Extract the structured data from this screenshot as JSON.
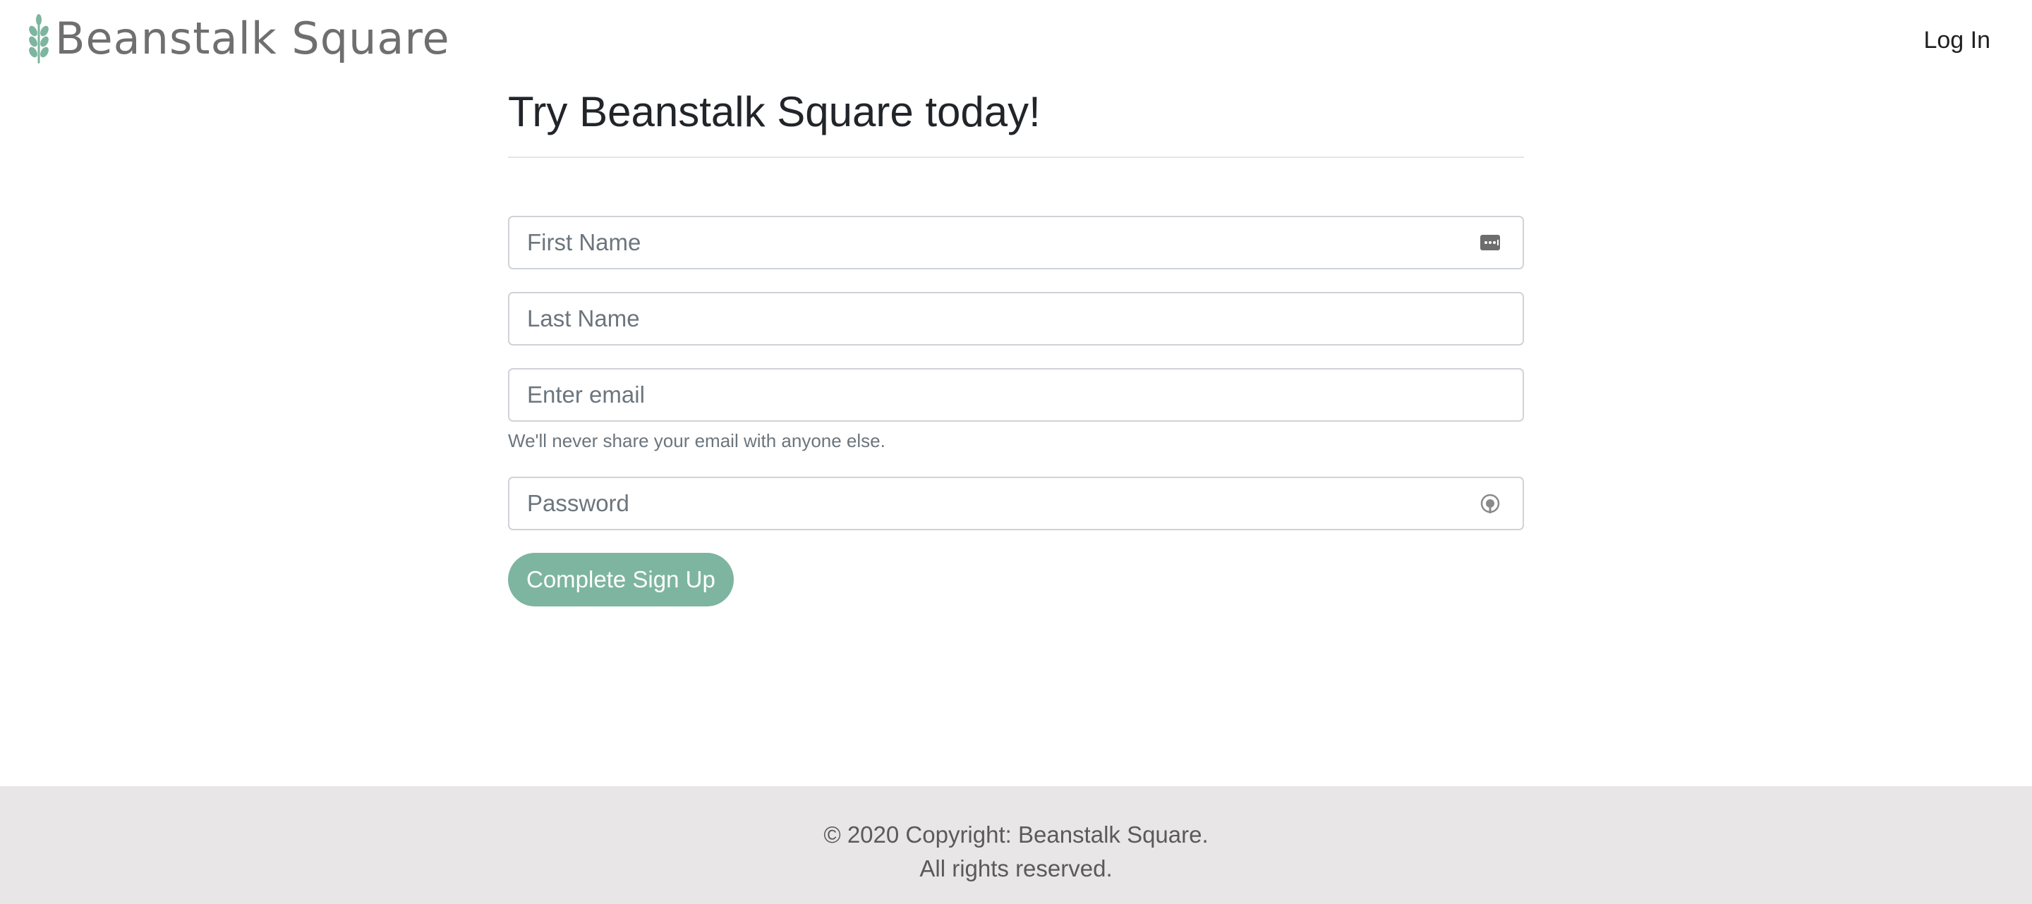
{
  "header": {
    "brand_name": "Beanstalk Square",
    "login_label": "Log In",
    "logo_icon": "wheat-leaf-icon",
    "brand_color": "#7db5a1"
  },
  "form": {
    "title": "Try Beanstalk Square today!",
    "first_name": {
      "placeholder": "First Name",
      "value": "",
      "icon": "autofill-contact-icon"
    },
    "last_name": {
      "placeholder": "Last Name",
      "value": ""
    },
    "email": {
      "placeholder": "Enter email",
      "value": "",
      "help": "We'll never share your email with anyone else."
    },
    "password": {
      "placeholder": "Password",
      "value": "",
      "icon": "password-key-icon"
    },
    "submit_label": "Complete Sign Up",
    "submit_color": "#7db5a1"
  },
  "footer": {
    "line1": "© 2020 Copyright: Beanstalk Square.",
    "line2": "All rights reserved."
  }
}
